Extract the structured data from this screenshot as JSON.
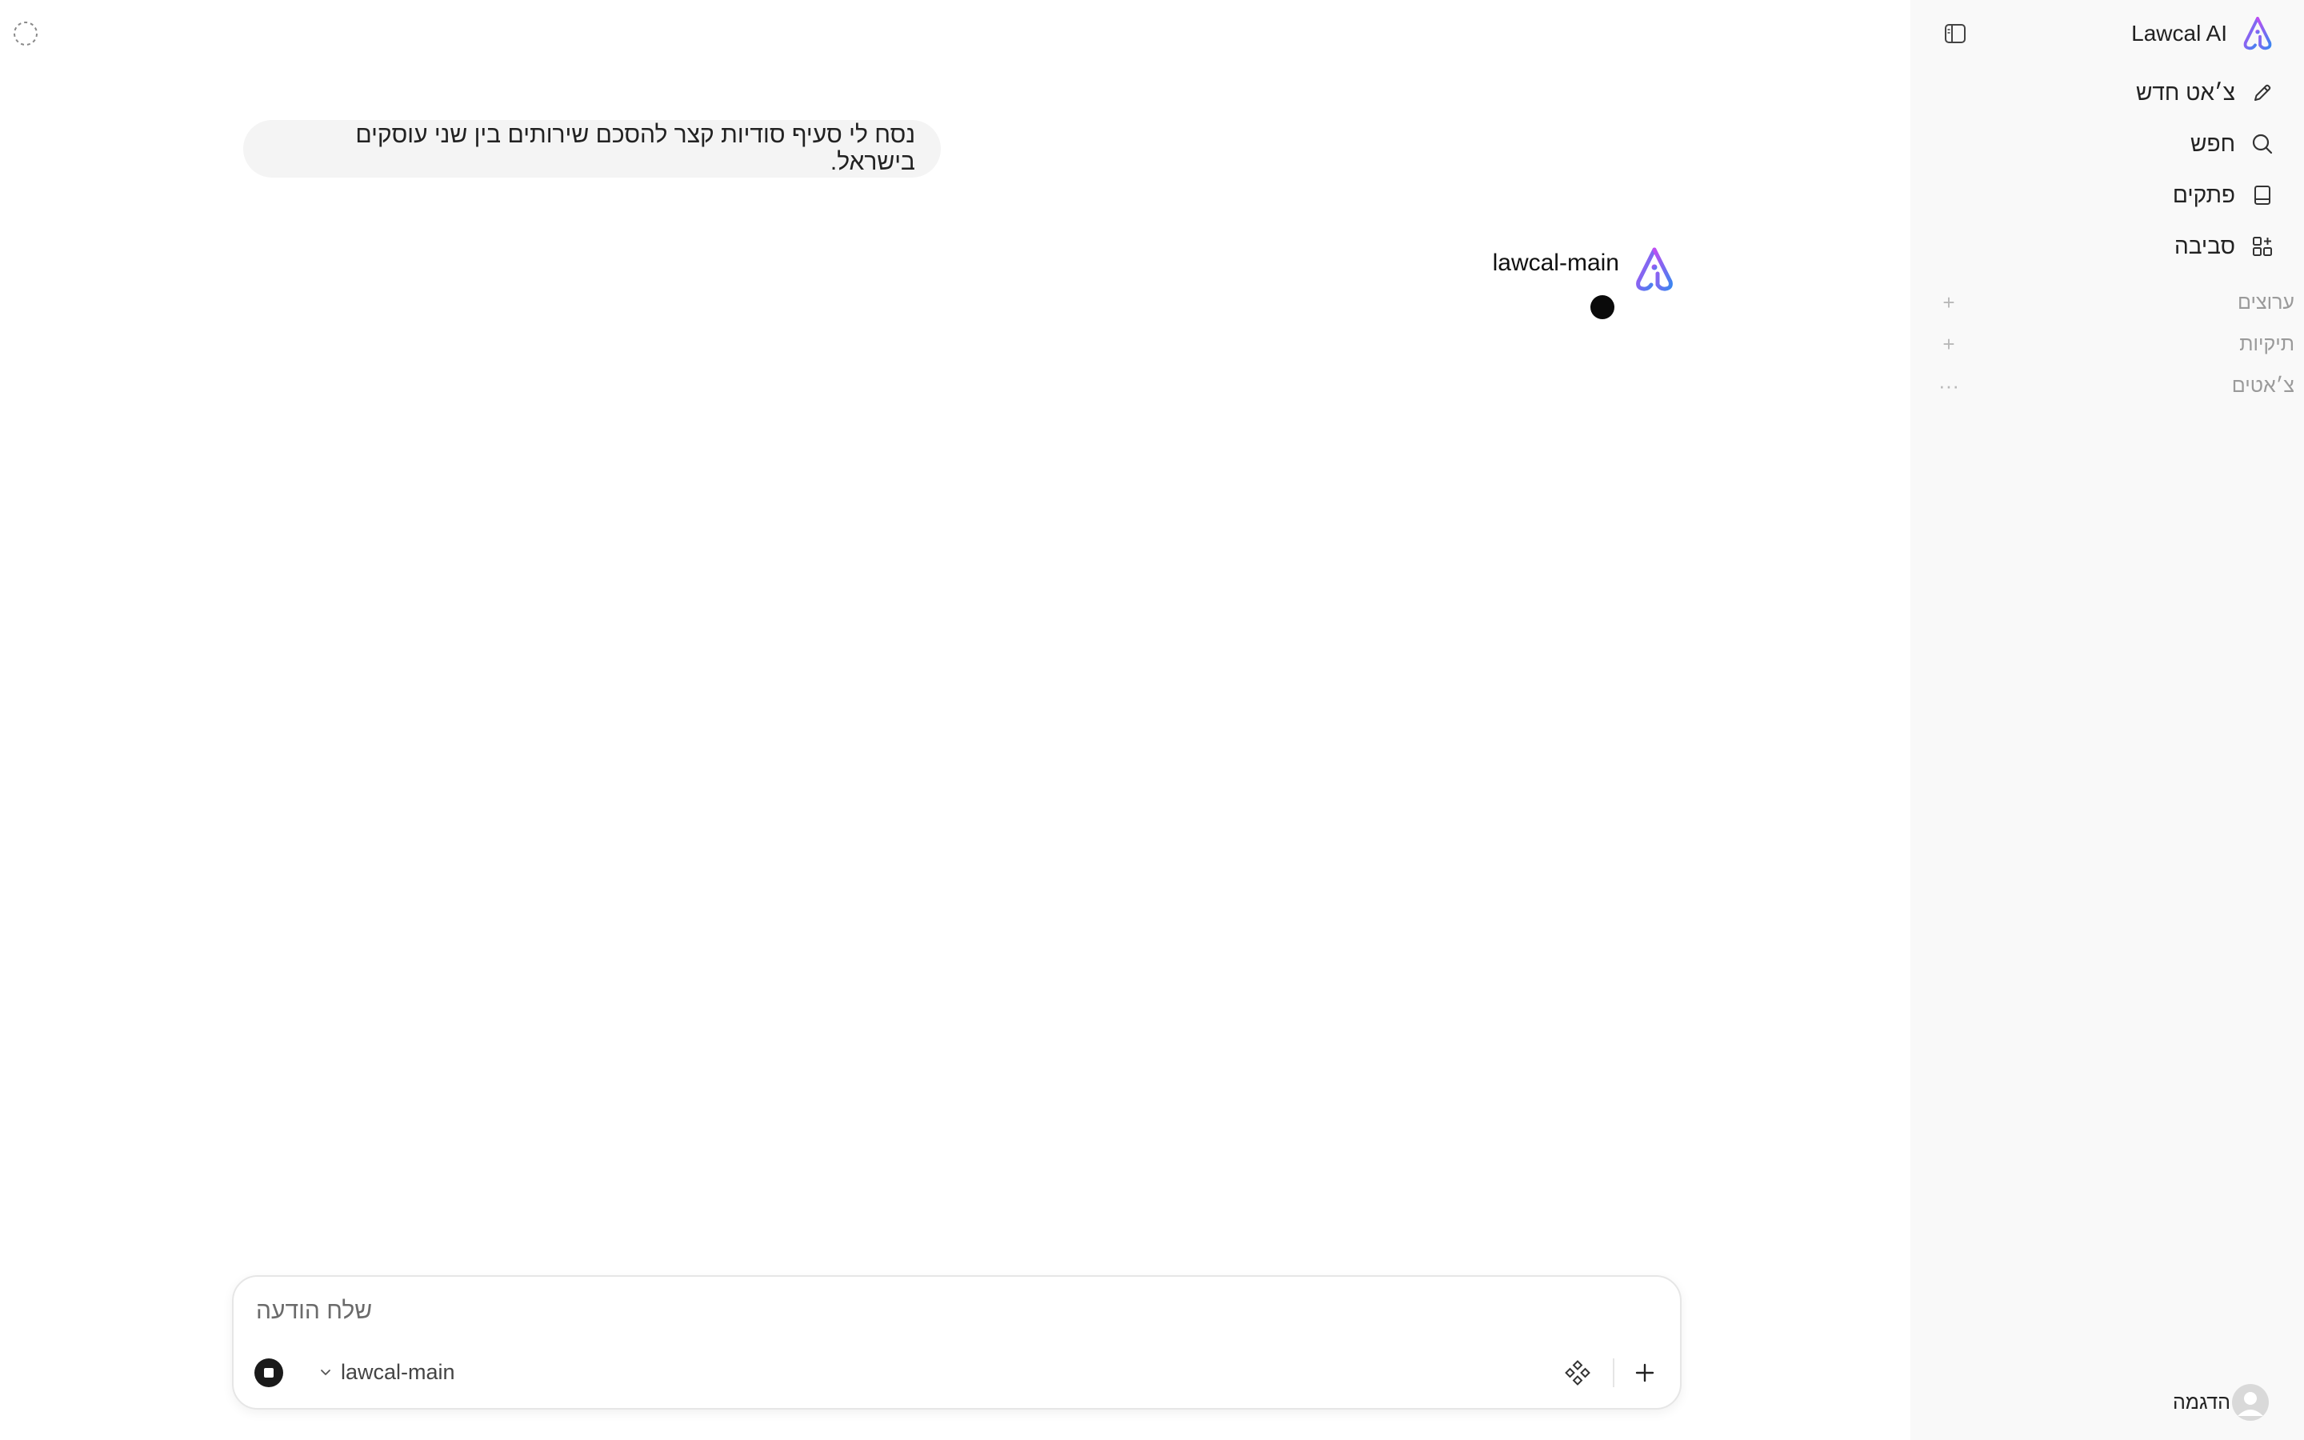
{
  "sidebar": {
    "brand_title": "Lawcal AI",
    "nav": [
      {
        "label": "צ׳אט חדש",
        "icon": "pencil-icon"
      },
      {
        "label": "חפש",
        "icon": "search-icon"
      },
      {
        "label": "פתקים",
        "icon": "notebook-icon"
      },
      {
        "label": "סביבה",
        "icon": "grid-plus-icon"
      }
    ],
    "sections": [
      {
        "label": "ערוצים",
        "action": "+"
      },
      {
        "label": "תיקיות",
        "action": "+"
      },
      {
        "label": "צ׳אטים",
        "action": "···"
      }
    ],
    "user_name": "הדגמה"
  },
  "chat": {
    "user_message": "נסח לי סעיף סודיות קצר להסכם שירותים בין שני עוסקים בישראל.",
    "assistant_name": "lawcal-main"
  },
  "composer": {
    "placeholder": "שלח הודעה",
    "model": "lawcal-main"
  },
  "colors": {
    "sidebar_bg": "#f9f9f9",
    "bubble_bg": "#f4f4f4",
    "brand_gradient_start": "#b84cf0",
    "brand_gradient_end": "#3c8cf0"
  }
}
